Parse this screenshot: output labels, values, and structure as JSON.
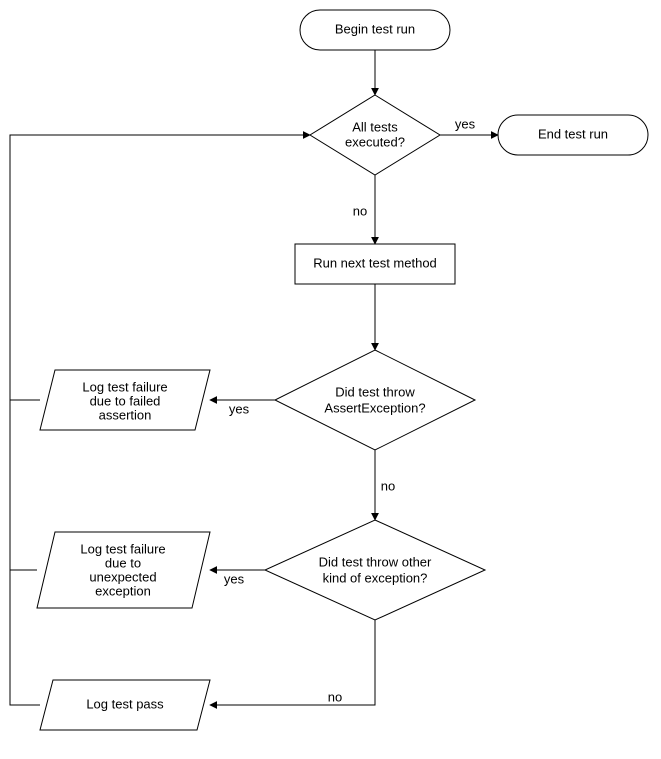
{
  "nodes": {
    "start": {
      "label": "Begin test run"
    },
    "end": {
      "label": "End test run"
    },
    "allExec": {
      "line1": "All tests",
      "line2": "executed?"
    },
    "runNext": {
      "label": "Run next test method"
    },
    "assertEx": {
      "line1": "Did test throw",
      "line2": "AssertException?"
    },
    "otherEx": {
      "line1": "Did test throw other",
      "line2": "kind of exception?"
    },
    "logAssert": {
      "line1": "Log test failure",
      "line2": "due to failed",
      "line3": "assertion"
    },
    "logOther": {
      "line1": "Log test failure",
      "line2": "due to",
      "line3": "unexpected",
      "line4": "exception"
    },
    "logPass": {
      "label": "Log test pass"
    }
  },
  "edges": {
    "yes": "yes",
    "no": "no"
  },
  "chart_data": {
    "type": "flowchart",
    "nodes": [
      {
        "id": "start",
        "kind": "terminator",
        "text": "Begin test run"
      },
      {
        "id": "allExec",
        "kind": "decision",
        "text": "All tests executed?"
      },
      {
        "id": "end",
        "kind": "terminator",
        "text": "End test run"
      },
      {
        "id": "runNext",
        "kind": "process",
        "text": "Run next test method"
      },
      {
        "id": "assertEx",
        "kind": "decision",
        "text": "Did test throw AssertException?"
      },
      {
        "id": "logAssert",
        "kind": "io",
        "text": "Log test failure due to failed assertion"
      },
      {
        "id": "otherEx",
        "kind": "decision",
        "text": "Did test throw other kind of exception?"
      },
      {
        "id": "logOther",
        "kind": "io",
        "text": "Log test failure due to unexpected exception"
      },
      {
        "id": "logPass",
        "kind": "io",
        "text": "Log test pass"
      }
    ],
    "edges": [
      {
        "from": "start",
        "to": "allExec"
      },
      {
        "from": "allExec",
        "to": "end",
        "label": "yes"
      },
      {
        "from": "allExec",
        "to": "runNext",
        "label": "no"
      },
      {
        "from": "runNext",
        "to": "assertEx"
      },
      {
        "from": "assertEx",
        "to": "logAssert",
        "label": "yes"
      },
      {
        "from": "assertEx",
        "to": "otherEx",
        "label": "no"
      },
      {
        "from": "otherEx",
        "to": "logOther",
        "label": "yes"
      },
      {
        "from": "otherEx",
        "to": "logPass",
        "label": "no"
      },
      {
        "from": "logAssert",
        "to": "allExec"
      },
      {
        "from": "logOther",
        "to": "allExec"
      },
      {
        "from": "logPass",
        "to": "allExec"
      }
    ]
  }
}
